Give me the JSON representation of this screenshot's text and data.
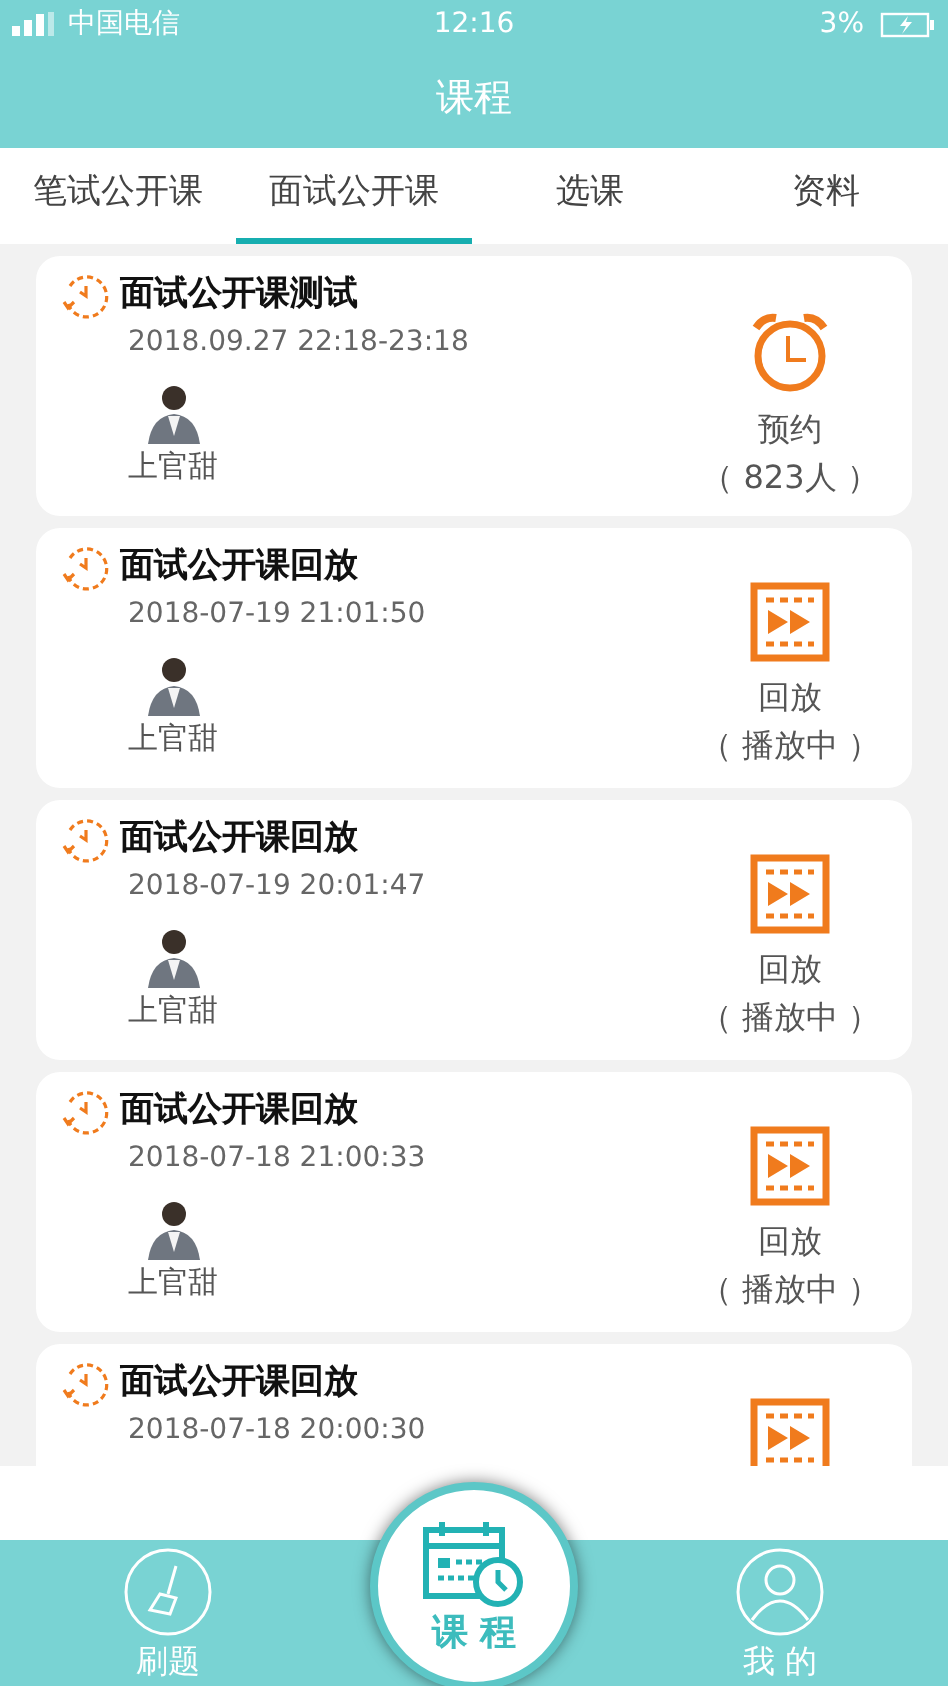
{
  "status_bar": {
    "carrier": "中国电信",
    "time": "12:16",
    "battery": "3%"
  },
  "header": {
    "title": "课程"
  },
  "tabs": [
    {
      "label": "笔试公开课",
      "selected": false
    },
    {
      "label": "面试公开课",
      "selected": true
    },
    {
      "label": "选课",
      "selected": false
    },
    {
      "label": "资料",
      "selected": false
    }
  ],
  "courses": [
    {
      "title": "面试公开课测试",
      "time": "2018.09.27 22:18-23:18",
      "teacher": "上官甜",
      "kind": "reserve",
      "action": "预约",
      "count": "（ 823人 ）"
    },
    {
      "title": "面试公开课回放",
      "time": "2018-07-19 21:01:50",
      "teacher": "上官甜",
      "kind": "replay",
      "action": "回放",
      "count": "（ 播放中 ）"
    },
    {
      "title": "面试公开课回放",
      "time": "2018-07-19 20:01:47",
      "teacher": "上官甜",
      "kind": "replay",
      "action": "回放",
      "count": "（ 播放中 ）"
    },
    {
      "title": "面试公开课回放",
      "time": "2018-07-18 21:00:33",
      "teacher": "上官甜",
      "kind": "replay",
      "action": "回放",
      "count": "（ 播放中 ）"
    },
    {
      "title": "面试公开课回放",
      "time": "2018-07-18 20:00:30",
      "kind": "replay"
    }
  ],
  "nav": [
    {
      "label": "刷题",
      "kind": "brush",
      "selected": false
    },
    {
      "label": "课 程",
      "kind": "calendar",
      "selected": true
    },
    {
      "label": "我 的",
      "kind": "user",
      "selected": false
    }
  ]
}
